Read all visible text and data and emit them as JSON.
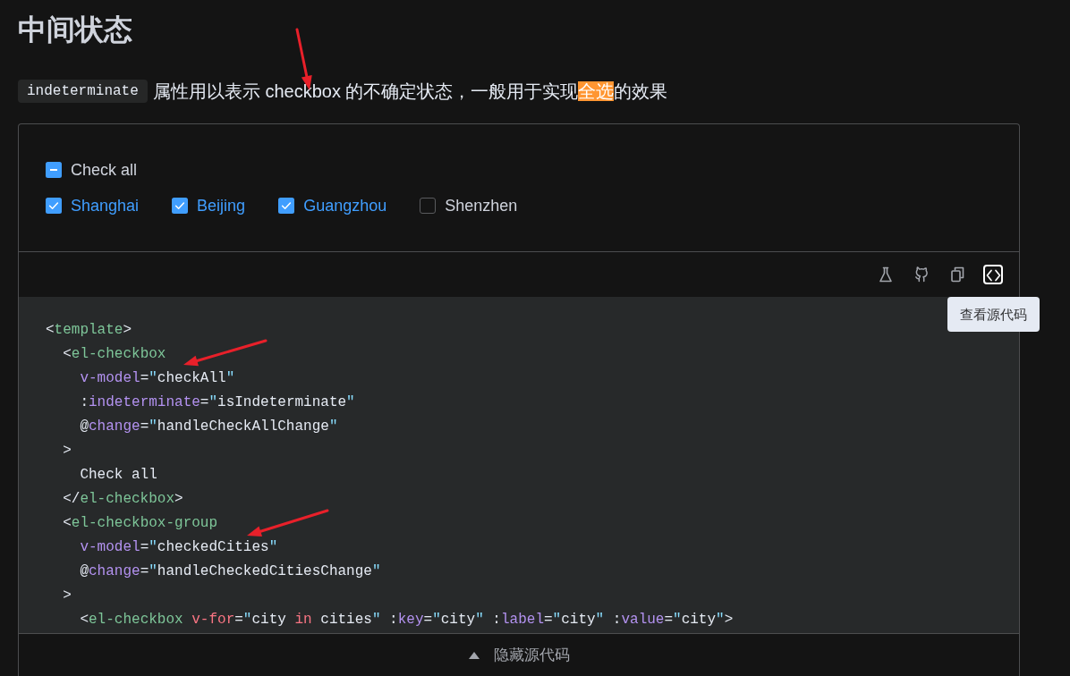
{
  "heading": "中间状态",
  "description": {
    "code": "indeterminate",
    "parts": [
      {
        "text": "属性用以表示 checkbox 的不确定状态，一般用于实现",
        "highlighted": false
      },
      {
        "text": "全选",
        "highlighted": true
      },
      {
        "text": "的效果",
        "highlighted": false
      }
    ]
  },
  "demo": {
    "check_all": {
      "label": "Check all",
      "checked": false,
      "indeterminate": true
    },
    "cities": [
      {
        "label": "Shanghai",
        "checked": true
      },
      {
        "label": "Beijing",
        "checked": true
      },
      {
        "label": "Guangzhou",
        "checked": true
      },
      {
        "label": "Shenzhen",
        "checked": false
      }
    ]
  },
  "toolbar": {
    "buttons": [
      {
        "kind": "flask",
        "focused": false
      },
      {
        "kind": "cat",
        "focused": false
      },
      {
        "kind": "copy",
        "focused": false
      },
      {
        "kind": "code",
        "focused": true,
        "tooltip": "查看源代码"
      }
    ]
  },
  "code": {
    "lines": [
      {
        "tokens": [
          {
            "kind": "punct",
            "text": "<"
          },
          {
            "kind": "tag",
            "text": "template"
          },
          {
            "kind": "punct",
            "text": ">"
          }
        ]
      },
      {
        "tokens": [
          {
            "kind": "punct",
            "text": "  <"
          },
          {
            "kind": "tag",
            "text": "el-checkbox"
          }
        ]
      },
      {
        "tokens": [
          {
            "kind": "attr",
            "text": "    v-model"
          },
          {
            "kind": "punct",
            "text": "="
          },
          {
            "kind": "quote",
            "text": "\""
          },
          {
            "kind": "string",
            "text": "checkAll"
          },
          {
            "kind": "quote",
            "text": "\""
          }
        ]
      },
      {
        "tokens": [
          {
            "kind": "punct",
            "text": "    :"
          },
          {
            "kind": "attr",
            "text": "indeterminate"
          },
          {
            "kind": "punct",
            "text": "="
          },
          {
            "kind": "quote",
            "text": "\""
          },
          {
            "kind": "string",
            "text": "isIndeterminate"
          },
          {
            "kind": "quote",
            "text": "\""
          }
        ]
      },
      {
        "tokens": [
          {
            "kind": "punct",
            "text": "    @"
          },
          {
            "kind": "attr",
            "text": "change"
          },
          {
            "kind": "punct",
            "text": "="
          },
          {
            "kind": "quote",
            "text": "\""
          },
          {
            "kind": "string",
            "text": "handleCheckAllChange"
          },
          {
            "kind": "quote",
            "text": "\""
          }
        ]
      },
      {
        "tokens": [
          {
            "kind": "punct",
            "text": "  >"
          }
        ]
      },
      {
        "tokens": [
          {
            "kind": "text",
            "text": "    Check all"
          }
        ]
      },
      {
        "tokens": [
          {
            "kind": "punct",
            "text": "  </"
          },
          {
            "kind": "tag",
            "text": "el-checkbox"
          },
          {
            "kind": "punct",
            "text": ">"
          }
        ]
      },
      {
        "tokens": [
          {
            "kind": "punct",
            "text": "  <"
          },
          {
            "kind": "tag",
            "text": "el-checkbox-group"
          }
        ]
      },
      {
        "tokens": [
          {
            "kind": "attr",
            "text": "    v-model"
          },
          {
            "kind": "punct",
            "text": "="
          },
          {
            "kind": "quote",
            "text": "\""
          },
          {
            "kind": "string",
            "text": "checkedCities"
          },
          {
            "kind": "quote",
            "text": "\""
          }
        ]
      },
      {
        "tokens": [
          {
            "kind": "punct",
            "text": "    @"
          },
          {
            "kind": "attr",
            "text": "change"
          },
          {
            "kind": "punct",
            "text": "="
          },
          {
            "kind": "quote",
            "text": "\""
          },
          {
            "kind": "string",
            "text": "handleCheckedCitiesChange"
          },
          {
            "kind": "quote",
            "text": "\""
          }
        ]
      },
      {
        "tokens": [
          {
            "kind": "punct",
            "text": "  >"
          }
        ]
      },
      {
        "tokens": [
          {
            "kind": "punct",
            "text": "    <"
          },
          {
            "kind": "tag",
            "text": "el-checkbox"
          },
          {
            "kind": "keyword",
            "text": " v-for"
          },
          {
            "kind": "punct",
            "text": "="
          },
          {
            "kind": "quote",
            "text": "\""
          },
          {
            "kind": "string",
            "text": "city "
          },
          {
            "kind": "keyword",
            "text": "in"
          },
          {
            "kind": "string",
            "text": " cities"
          },
          {
            "kind": "quote",
            "text": "\""
          },
          {
            "kind": "punct",
            "text": " :"
          },
          {
            "kind": "attr",
            "text": "key"
          },
          {
            "kind": "punct",
            "text": "="
          },
          {
            "kind": "quote",
            "text": "\""
          },
          {
            "kind": "string",
            "text": "city"
          },
          {
            "kind": "quote",
            "text": "\""
          },
          {
            "kind": "punct",
            "text": " :"
          },
          {
            "kind": "attr",
            "text": "label"
          },
          {
            "kind": "punct",
            "text": "="
          },
          {
            "kind": "quote",
            "text": "\""
          },
          {
            "kind": "string",
            "text": "city"
          },
          {
            "kind": "quote",
            "text": "\""
          },
          {
            "kind": "punct",
            "text": " :"
          },
          {
            "kind": "attr",
            "text": "value"
          },
          {
            "kind": "punct",
            "text": "="
          },
          {
            "kind": "quote",
            "text": "\""
          },
          {
            "kind": "string",
            "text": "city"
          },
          {
            "kind": "quote",
            "text": "\""
          },
          {
            "kind": "punct",
            "text": ">"
          }
        ]
      }
    ]
  },
  "footer": {
    "label": "隐藏源代码"
  }
}
